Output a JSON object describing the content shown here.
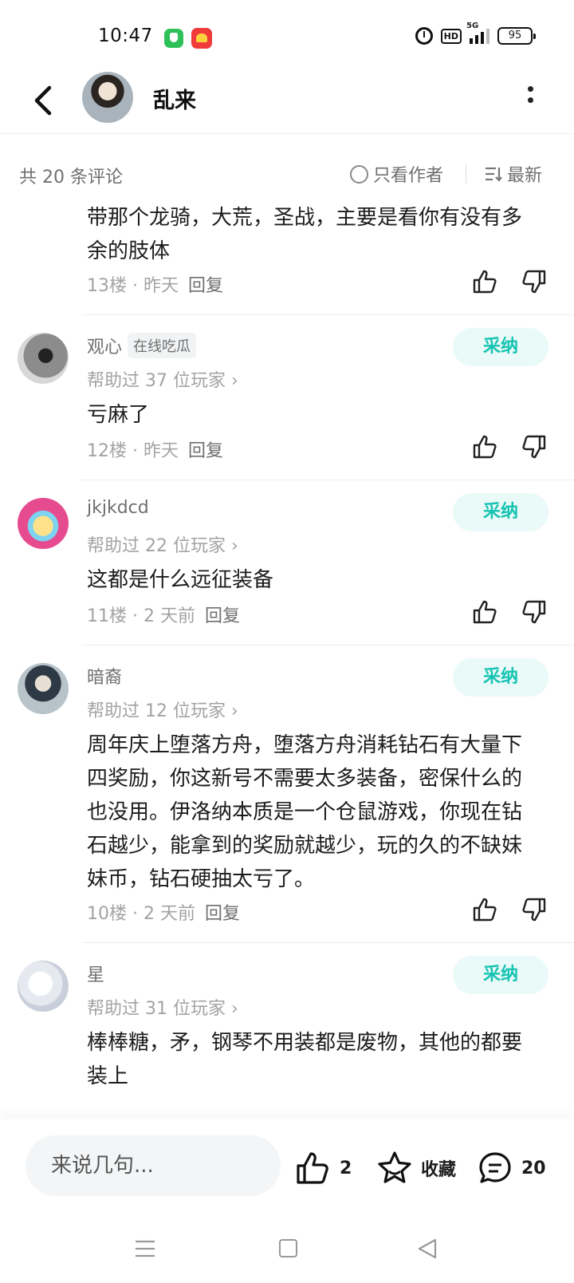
{
  "status_bar": {
    "time": "10:47",
    "network": "5G",
    "battery": "95"
  },
  "header": {
    "author_name": "乱来"
  },
  "filter": {
    "count_text": "共 20 条评论",
    "only_author": "只看作者",
    "sort": "最新"
  },
  "comments": [
    {
      "text": "带那个龙骑，大荒，圣战，主要是看你有没有多余的肢体",
      "floor": "13楼 · 昨天",
      "reply": "回复"
    },
    {
      "name": "观心",
      "tag": "在线吃瓜",
      "help": "帮助过 37 位玩家 ›",
      "adopt": "采纳",
      "text": "亏麻了",
      "floor": "12楼 · 昨天",
      "reply": "回复"
    },
    {
      "name": "jkjkdcd",
      "help": "帮助过 22 位玩家 ›",
      "adopt": "采纳",
      "text": "这都是什么远征装备",
      "floor": "11楼 · 2 天前",
      "reply": "回复"
    },
    {
      "name": "暗裔",
      "help": "帮助过 12 位玩家 ›",
      "adopt": "采纳",
      "text": "周年庆上堕落方舟，堕落方舟消耗钻石有大量下四奖励，你这新号不需要太多装备，密保什么的也没用。伊洛纳本质是一个仓鼠游戏，你现在钻石越少，能拿到的奖励就越少，玩的久的不缺妹妹币，钻石硬抽太亏了。",
      "floor": "10楼 · 2 天前",
      "reply": "回复"
    },
    {
      "name": "星",
      "help": "帮助过 31 位玩家 ›",
      "adopt": "采纳",
      "text": "棒棒糖，矛，钢琴不用装都是废物，其他的都要装上"
    }
  ],
  "bottom_bar": {
    "input_placeholder": "来说几句...",
    "like_count": "2",
    "favorite_label": "收藏",
    "comment_count": "20"
  },
  "colors": {
    "accent": "#17c3b2",
    "adopt_bg": "#eafaf8",
    "muted": "#a3a3a3"
  }
}
